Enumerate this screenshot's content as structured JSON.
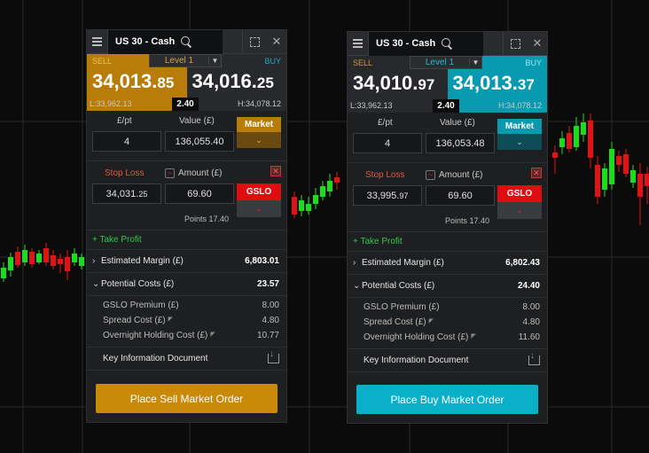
{
  "colors": {
    "sell_accent": "#b87c08",
    "buy_accent": "#0a9ab0",
    "gslo_red": "#e00d10",
    "take_profit_green": "#2ec84a",
    "stop_loss_label": "#e2583c",
    "candle_up": "#18e018",
    "candle_down": "#e31313"
  },
  "left_ticket": {
    "title": "US 30 - Cash",
    "icons": {
      "menu": "hamburger-menu-icon",
      "search": "search-icon",
      "expand": "expand-icon",
      "close": "close-icon"
    },
    "active_side": "sell",
    "level": "Level 1",
    "sell": {
      "label": "SELL",
      "price_main": "34,013.",
      "price_dec": "85",
      "low": "L:33,962.13"
    },
    "buy": {
      "label": "BUY",
      "price_main": "34,016.",
      "price_dec": "25",
      "high": "H:34,078.12"
    },
    "spread": "2.40",
    "qty": {
      "per_pt_label": "£/pt",
      "per_pt_value": "4",
      "value_label": "Value (£)",
      "value_value": "136,055.40",
      "market_label": "Market"
    },
    "stop": {
      "label": "Stop Loss",
      "value_main": "34,031.",
      "value_dec": "25",
      "amount_label": "Amount (£)",
      "amount_value": "69.60",
      "gslo_label": "GSLO",
      "points": "Points 17.40"
    },
    "take_profit": "+ Take Profit",
    "estimated_margin": {
      "label": "Estimated Margin (£)",
      "value": "6,803.01"
    },
    "potential_costs": {
      "label": "Potential Costs (£)",
      "value": "23.57"
    },
    "costs": [
      {
        "label": "GSLO Premium (£)",
        "value": "8.00",
        "info": false
      },
      {
        "label": "Spread Cost (£)",
        "value": "4.80",
        "info": true
      },
      {
        "label": "Overnight Holding Cost (£)",
        "value": "10.77",
        "info": true
      }
    ],
    "kid": "Key Information Document",
    "order_button": "Place Sell Market Order"
  },
  "right_ticket": {
    "title": "US 30 - Cash",
    "icons": {
      "menu": "hamburger-menu-icon",
      "search": "search-icon",
      "expand": "expand-icon",
      "close": "close-icon"
    },
    "active_side": "buy",
    "level": "Level 1",
    "sell": {
      "label": "SELL",
      "price_main": "34,010.",
      "price_dec": "97",
      "low": "L:33,962.13"
    },
    "buy": {
      "label": "BUY",
      "price_main": "34,013.",
      "price_dec": "37",
      "high": "H:34,078.12"
    },
    "spread": "2.40",
    "qty": {
      "per_pt_label": "£/pt",
      "per_pt_value": "4",
      "value_label": "Value (£)",
      "value_value": "136,053.48",
      "market_label": "Market"
    },
    "stop": {
      "label": "Stop Loss",
      "value_main": "33,995.",
      "value_dec": "97",
      "amount_label": "Amount (£)",
      "amount_value": "69.60",
      "gslo_label": "GSLO",
      "points": "Points 17.40"
    },
    "take_profit": "+ Take Profit",
    "estimated_margin": {
      "label": "Estimated Margin (£)",
      "value": "6,802.43"
    },
    "potential_costs": {
      "label": "Potential Costs (£)",
      "value": "24.40"
    },
    "costs": [
      {
        "label": "GSLO Premium (£)",
        "value": "8.00",
        "info": false
      },
      {
        "label": "Spread Cost (£)",
        "value": "4.80",
        "info": true
      },
      {
        "label": "Overnight Holding Cost (£)",
        "value": "11.60",
        "info": true
      }
    ],
    "kid": "Key Information Document",
    "order_button": "Place Buy Market Order"
  }
}
